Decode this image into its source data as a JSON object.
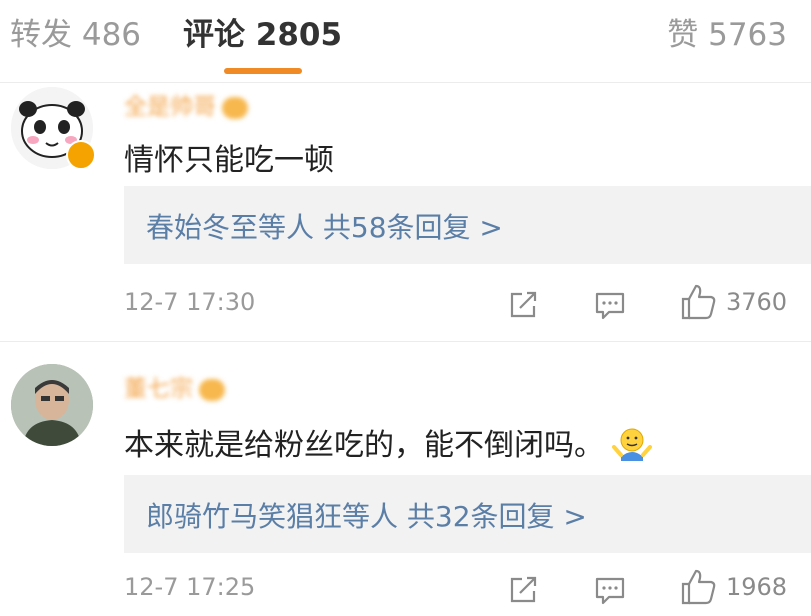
{
  "tabs": {
    "repost": "转发 486",
    "comments": "评论 2805",
    "likes": "赞 5763"
  },
  "comments": [
    {
      "username": "全是帅哥",
      "text": "情怀只能吃一顿",
      "replies": "春始冬至等人  共58条回复 >",
      "time": "12-7 17:30",
      "likes": "3760"
    },
    {
      "username": "董七宗",
      "text": "本来就是给粉丝吃的，能不倒闭吗。",
      "replies": "郎骑竹马笑猖狂等人  共32条回复 >",
      "time": "12-7 17:25",
      "likes": "1968"
    }
  ],
  "colors": {
    "accent": "#f08a24",
    "link": "#5b7ea7",
    "muted": "#9a9a9a"
  },
  "icons": [
    "share-icon",
    "comment-icon",
    "like-icon",
    "verified-badge-icon",
    "shrug-emoji-icon"
  ]
}
